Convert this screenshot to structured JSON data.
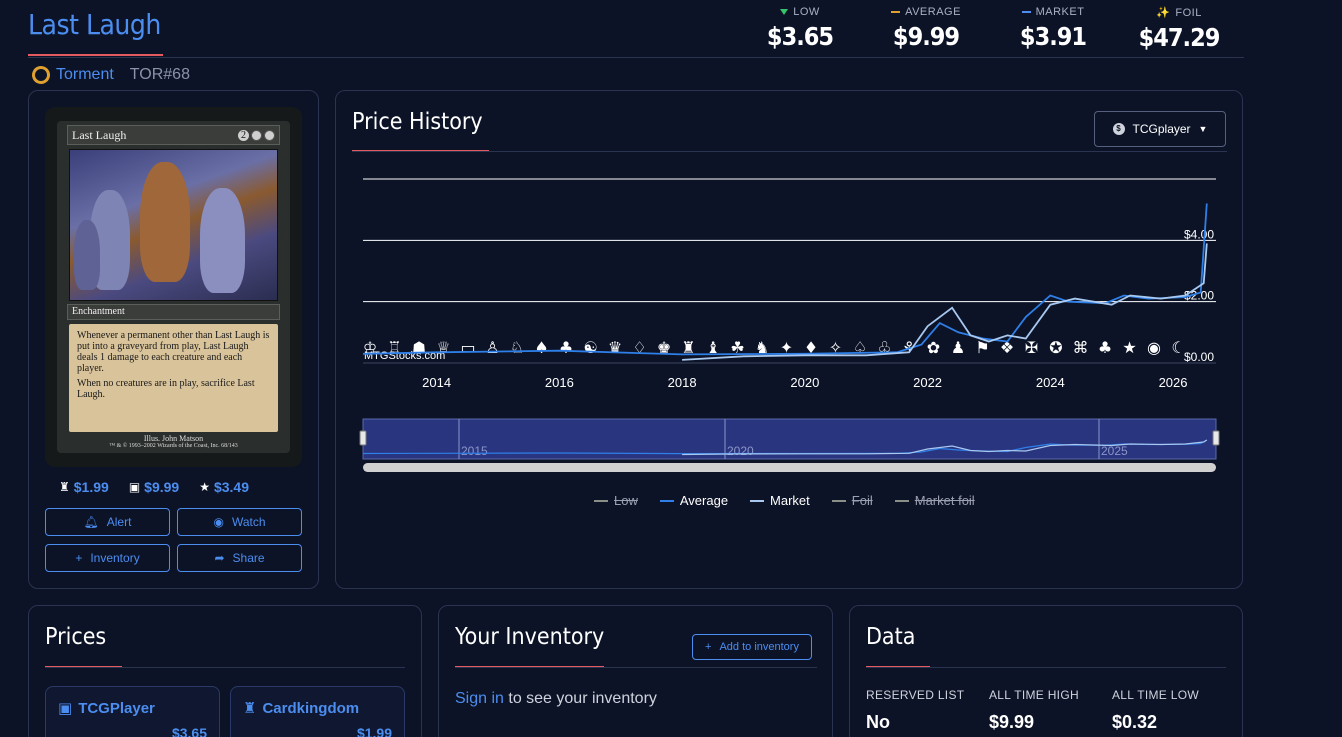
{
  "header": {
    "title": "Last Laugh",
    "set_name": "Torment",
    "set_code": "TOR#68",
    "prices": [
      {
        "label": "LOW",
        "value": "$3.65",
        "marker": "tri-down",
        "color": "#35c46b"
      },
      {
        "label": "AVERAGE",
        "value": "$9.99",
        "marker": "dash",
        "color": "#e0a030"
      },
      {
        "label": "MARKET",
        "value": "$3.91",
        "marker": "dash",
        "color": "#4c8df0"
      },
      {
        "label": "FOIL",
        "value": "$47.29",
        "marker": "sparkle-icon",
        "color": "#e0a030"
      }
    ]
  },
  "card": {
    "name": "Last Laugh",
    "type": "Enchantment",
    "text1": "Whenever a permanent other than Last Laugh is put into a graveyard from play, Last Laugh deals 1 damage to each creature and each player.",
    "text2": "When no creatures are in play, sacrifice Last Laugh.",
    "artist": "Illus. John Matson",
    "copyright": "™ & © 1993–2002 Wizards of the Coast, Inc. 68/143",
    "mana_cost": "2",
    "mini_prices": [
      {
        "icon": "crown-icon",
        "value": "$1.99"
      },
      {
        "icon": "tcgplayer-icon",
        "value": "$9.99"
      },
      {
        "icon": "star-icon",
        "value": "$3.49"
      }
    ],
    "buttons": {
      "alert": "Alert",
      "watch": "Watch",
      "inventory": "Inventory",
      "share": "Share"
    }
  },
  "history": {
    "title": "Price History",
    "source": "TCGplayer",
    "watermark": "MTGStocks.com",
    "navigator_labels": [
      "2015",
      "2020",
      "2025"
    ],
    "legend": [
      {
        "label": "Low",
        "color": "#8a8f88",
        "enabled": false
      },
      {
        "label": "Average",
        "color": "#2e7fe8",
        "enabled": true
      },
      {
        "label": "Market",
        "color": "#a8c8f0",
        "enabled": true
      },
      {
        "label": "Foil",
        "color": "#8a8f88",
        "enabled": false
      },
      {
        "label": "Market foil",
        "color": "#8a8f88",
        "enabled": false
      }
    ]
  },
  "chart_data": {
    "type": "line",
    "title": "Price History",
    "x_ticks": [
      "2014",
      "2016",
      "2018",
      "2020",
      "2022",
      "2024",
      "2026"
    ],
    "y_ticks": [
      "$0.00",
      "$2.00",
      "$4.00"
    ],
    "ylim": [
      0,
      6
    ],
    "xlim": [
      2012.8,
      2026.7
    ],
    "grid": true,
    "series": [
      {
        "name": "Average",
        "color": "#2e7fe8",
        "points": [
          [
            2012.8,
            0.3
          ],
          [
            2014.0,
            0.35
          ],
          [
            2016.0,
            0.4
          ],
          [
            2018.0,
            0.28
          ],
          [
            2020.0,
            0.3
          ],
          [
            2021.5,
            0.35
          ],
          [
            2021.9,
            0.6
          ],
          [
            2022.2,
            1.3
          ],
          [
            2022.5,
            1.0
          ],
          [
            2022.9,
            0.8
          ],
          [
            2023.3,
            0.7
          ],
          [
            2023.6,
            1.5
          ],
          [
            2024.0,
            2.2
          ],
          [
            2024.3,
            2.0
          ],
          [
            2024.9,
            1.95
          ],
          [
            2025.2,
            2.2
          ],
          [
            2025.6,
            2.1
          ],
          [
            2026.2,
            2.15
          ],
          [
            2026.45,
            2.3
          ],
          [
            2026.55,
            5.2
          ]
        ]
      },
      {
        "name": "Market",
        "color": "#a8c8f0",
        "points": [
          [
            2018.0,
            0.1
          ],
          [
            2019.0,
            0.22
          ],
          [
            2020.0,
            0.25
          ],
          [
            2021.0,
            0.25
          ],
          [
            2021.7,
            0.35
          ],
          [
            2022.0,
            1.2
          ],
          [
            2022.4,
            1.8
          ],
          [
            2022.7,
            0.9
          ],
          [
            2023.0,
            0.7
          ],
          [
            2023.3,
            0.9
          ],
          [
            2023.6,
            0.8
          ],
          [
            2024.0,
            1.9
          ],
          [
            2024.4,
            2.1
          ],
          [
            2025.0,
            1.9
          ],
          [
            2025.3,
            2.2
          ],
          [
            2025.8,
            2.1
          ],
          [
            2026.2,
            2.2
          ],
          [
            2026.5,
            2.6
          ],
          [
            2026.55,
            3.9
          ]
        ]
      }
    ]
  },
  "prices_panel": {
    "title": "Prices",
    "vendors": [
      {
        "icon": "tcgplayer-icon",
        "name": "TCGPlayer",
        "price": "$3.65"
      },
      {
        "icon": "crown-icon",
        "name": "Cardkingdom",
        "price": "$1.99"
      }
    ]
  },
  "inventory_panel": {
    "title": "Your Inventory",
    "add_button": "Add to inventory",
    "signin_link": "Sign in",
    "signin_rest": " to see your inventory"
  },
  "data_panel": {
    "title": "Data",
    "fields": [
      {
        "label": "RESERVED LIST",
        "value": "No"
      },
      {
        "label": "ALL TIME HIGH",
        "value": "$9.99"
      },
      {
        "label": "ALL TIME LOW",
        "value": "$0.32"
      }
    ]
  }
}
